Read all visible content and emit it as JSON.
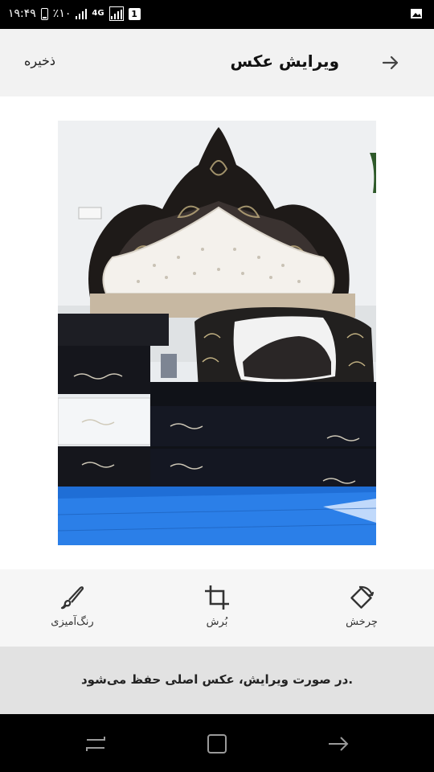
{
  "status_bar": {
    "time": "۱۹:۴۹",
    "battery": "٪۱۰",
    "network": "4G",
    "sim_badge": "1"
  },
  "header": {
    "title": "ویرایش عکس",
    "save_label": "ذخیره",
    "back_icon": "arrow-right-icon"
  },
  "photo": {
    "subject": "bed-with-headboard-and-mirror-photo"
  },
  "toolbar": {
    "tools": [
      {
        "label": "رنگ‌آمیزی",
        "icon": "paint-brush-icon"
      },
      {
        "label": "بُرش",
        "icon": "crop-icon"
      },
      {
        "label": "چرخش",
        "icon": "rotate-icon"
      }
    ]
  },
  "notice": {
    "text": "در صورت ویرایش، عکس اصلی حفظ می‌شود."
  },
  "colors": {
    "header_bg": "#f2f2f2",
    "toolbar_bg": "#f6f6f6",
    "notice_bg": "#e2e2e2",
    "status_bar_bg": "#000000"
  }
}
